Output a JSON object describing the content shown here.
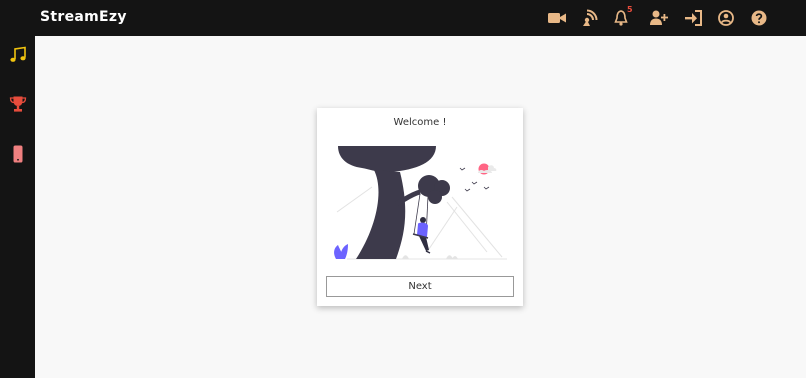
{
  "app": {
    "title": "StreamEzy"
  },
  "colors": {
    "topbar_bg": "#141414",
    "icon_tan": "#e8b887",
    "music_yellow": "#f1c40f",
    "trophy_red": "#e74c3c",
    "phone_pink": "#f08080",
    "badge_red": "#e74c3c",
    "illustration_dark": "#3d3a4b",
    "illustration_accent": "#6c63ff",
    "illustration_sun": "#ff6584"
  },
  "header": {
    "icons": [
      {
        "name": "video-camera-icon"
      },
      {
        "name": "broadcast-icon"
      },
      {
        "name": "bell-icon",
        "badge": "5"
      },
      {
        "name": "add-user-icon"
      },
      {
        "name": "sign-in-icon"
      },
      {
        "name": "user-circle-icon"
      },
      {
        "name": "help-icon"
      }
    ]
  },
  "sidebar": {
    "items": [
      {
        "name": "music-icon"
      },
      {
        "name": "trophy-icon"
      },
      {
        "name": "mobile-phone-icon"
      }
    ]
  },
  "welcome_card": {
    "title": "Welcome !",
    "illustration": "person-on-swing-under-tree",
    "next_label": "Next"
  }
}
